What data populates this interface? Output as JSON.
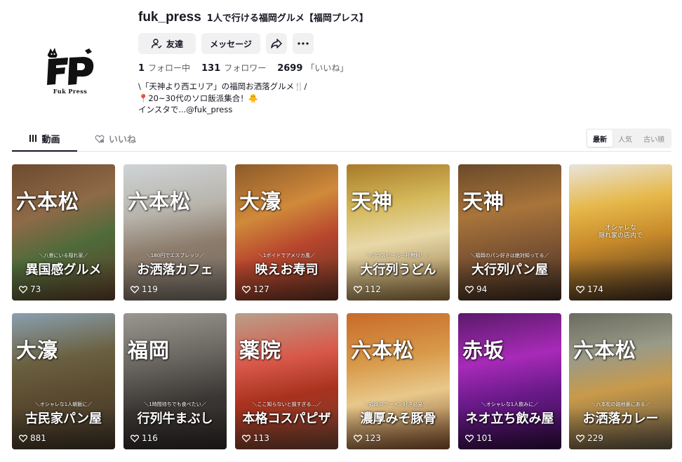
{
  "profile": {
    "username": "fuk_press",
    "nickname": "1人で行ける福岡グルメ【福岡プレス】",
    "logo_letters": "FP",
    "logo_text": "Fuk Press",
    "buttons": {
      "friend": "友達",
      "message": "メッセージ"
    },
    "stats": [
      {
        "value": "1",
        "label": "フォロー中"
      },
      {
        "value": "131",
        "label": "フォロワー"
      },
      {
        "value": "2699",
        "label": "「いいね」"
      }
    ],
    "bio": "\\「天神より西エリア」の福岡お洒落グルメ🍴/\n📍20~30代のソロ飯派集合！🐥\nインスタで...@fuk_press"
  },
  "tabs": {
    "videos": "動画",
    "likes": "いいね"
  },
  "sort": [
    "最新",
    "人気",
    "古い順"
  ],
  "colors": {
    "text": "#161823",
    "muted": "#8a8b91",
    "button_bg": "#f1f1f2"
  },
  "videos": [
    {
      "area": "六本松",
      "sub": "＼八景にいる隠れ家／",
      "headline": "異国感グルメ",
      "likes": "73",
      "bg": "linear-gradient(160deg,#6e4a2f 0%,#8e6a48 35%,#4f6b3a 60%,#5a3b28 100%)"
    },
    {
      "area": "六本松",
      "sub": "＼180円でエスプレッソ／",
      "headline": "お洒落カフェ",
      "likes": "119",
      "bg": "linear-gradient(170deg,#cfd4d6 0%,#b8b4ac 35%,#8c7c6c 60%,#6f675e 100%)"
    },
    {
      "area": "大濠",
      "sub": "＼1ポイドでアメリカ風／",
      "headline": "映えお寿司",
      "likes": "127",
      "bg": "linear-gradient(160deg,#8c5a2a 0%,#d08a3a 35%,#b8462e 60%,#5a3020 100%)"
    },
    {
      "area": "天神",
      "sub": "＼グラスビール一杯無料！／",
      "headline": "大行列うどん",
      "likes": "112",
      "bg": "linear-gradient(170deg,#a87a2a 0%,#d4b85a 30%,#e8d8a8 55%,#8a6a3a 100%)"
    },
    {
      "area": "天神",
      "sub": "＼福岡のパン好きは絶対知ってる／",
      "headline": "大行列パン屋",
      "likes": "94",
      "bg": "linear-gradient(170deg,#6a4a2a 0%,#a8743a 35%,#7a5232 65%,#3a2a1e 100%)"
    },
    {
      "area": "",
      "sub": "オシャレな\n隠れ家の店内で",
      "headline": "",
      "likes": "174",
      "bg": "linear-gradient(170deg,#e8e4dc 0%,#e6b84a 30%,#c88a2a 55%,#3a2a1e 100%)"
    },
    {
      "area": "大濠",
      "sub": "＼オシャレな1人朝飯に／",
      "headline": "古民家パン屋",
      "likes": "881",
      "bg": "linear-gradient(170deg,#8aa0b0 0%,#6a6040 35%,#5a4a30 60%,#3a3024 100%)"
    },
    {
      "area": "福岡",
      "sub": "＼1時間待ちでも食べたい／",
      "headline": "行列牛まぶし",
      "likes": "116",
      "bg": "linear-gradient(170deg,#9a9690 0%,#6a6660 35%,#3a3634 65%,#2a2624 100%)"
    },
    {
      "area": "薬院",
      "sub": "＼ここ知らないと損すぎる…／",
      "headline": "本格コスパピザ",
      "likes": "113",
      "bg": "linear-gradient(170deg,#b8a08a 0%,#d8584a 35%,#a8321e 60%,#6a4030 100%)"
    },
    {
      "area": "六本松",
      "sub": "＼福岡のラーメン好き必見！／",
      "headline": "濃厚みそ豚骨",
      "likes": "123",
      "bg": "linear-gradient(170deg,#c86a2a 0%,#d89a4a 35%,#e8c88a 60%,#7a4a2a 100%)"
    },
    {
      "area": "赤坂",
      "sub": "＼オシャレな1人飲みに／",
      "headline": "ネオ立ち飲み屋",
      "likes": "101",
      "bg": "linear-gradient(170deg,#5a1a6a 0%,#a82ab8 35%,#6a1a8a 60%,#2a0a3a 100%)"
    },
    {
      "area": "六本松",
      "sub": "＼六本松の路地裏にある／",
      "headline": "お洒落カレー",
      "likes": "229",
      "bg": "linear-gradient(170deg,#6a6a60 0%,#9a9a88 30%,#c89a4a 55%,#5a5040 100%)"
    }
  ]
}
